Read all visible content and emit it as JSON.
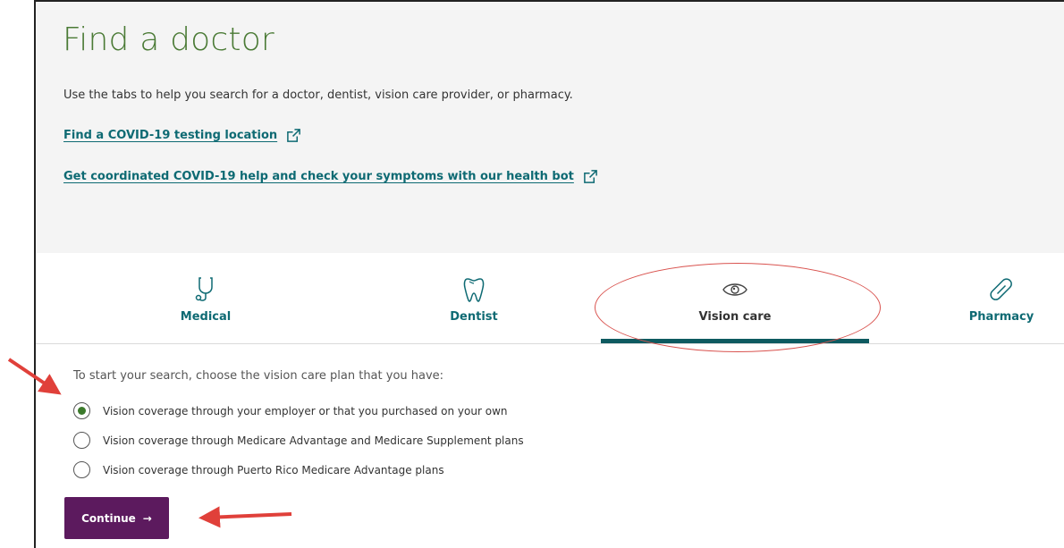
{
  "page": {
    "title": "Find a doctor",
    "intro": "Use the tabs to help you search for a doctor, dentist, vision care provider, or pharmacy.",
    "links": [
      {
        "label": "Find a COVID-19 testing location",
        "icon": "external-link-icon"
      },
      {
        "label": "Get coordinated COVID-19 help and check your symptoms with our health bot",
        "icon": "external-link-icon"
      }
    ]
  },
  "tabs": [
    {
      "label": "Medical",
      "icon": "stethoscope-icon"
    },
    {
      "label": "Dentist",
      "icon": "tooth-icon"
    },
    {
      "label": "Vision care",
      "icon": "eye-icon",
      "active": true
    },
    {
      "label": "Pharmacy",
      "icon": "pill-icon"
    }
  ],
  "vision": {
    "prompt": "To start your search, choose the vision care plan that you have:",
    "options": [
      {
        "label": "Vision coverage through your employer or that you purchased on your own",
        "selected": true
      },
      {
        "label": "Vision coverage through Medicare Advantage and Medicare Supplement plans",
        "selected": false
      },
      {
        "label": "Vision coverage through Puerto Rico Medicare Advantage plans",
        "selected": false
      }
    ],
    "continue_label": "Continue",
    "continue_arrow": "→"
  },
  "colors": {
    "title_green": "#4a7a35",
    "link_teal": "#0e6a73",
    "tab_underline": "#0e5a60",
    "button_purple": "#5c1a5e",
    "annotation_red": "#d9534f",
    "radio_green": "#3c7a2c"
  }
}
